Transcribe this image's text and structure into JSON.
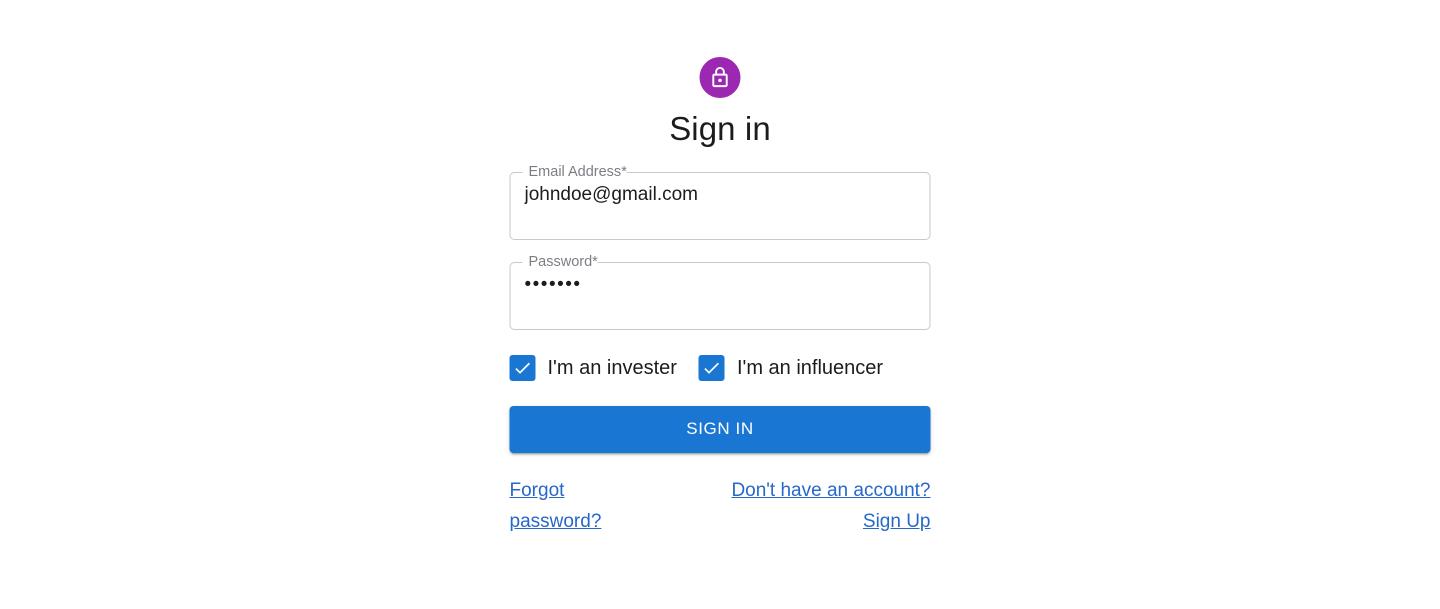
{
  "page": {
    "title": "Sign in",
    "avatar_icon": "lock-icon",
    "accent_purple": "#9c27b0",
    "accent_blue": "#1976d2",
    "link_color": "#2668c9",
    "background": "#ffffff"
  },
  "form": {
    "email": {
      "label": "Email Address",
      "required_mark": "*",
      "value": "johndoe@gmail.com",
      "placeholder": ""
    },
    "password": {
      "label": "Password",
      "required_mark": "*",
      "value": "•••••••",
      "placeholder": ""
    },
    "checkboxes": [
      {
        "label": "I'm an invester",
        "checked": true,
        "icon": "check-icon"
      },
      {
        "label": "I'm an influencer",
        "checked": true,
        "icon": "check-icon"
      }
    ],
    "submit_label": "SIGN IN"
  },
  "links": {
    "forgot_password": "Forgot password?",
    "sign_up": "Don't have an account? Sign Up"
  }
}
